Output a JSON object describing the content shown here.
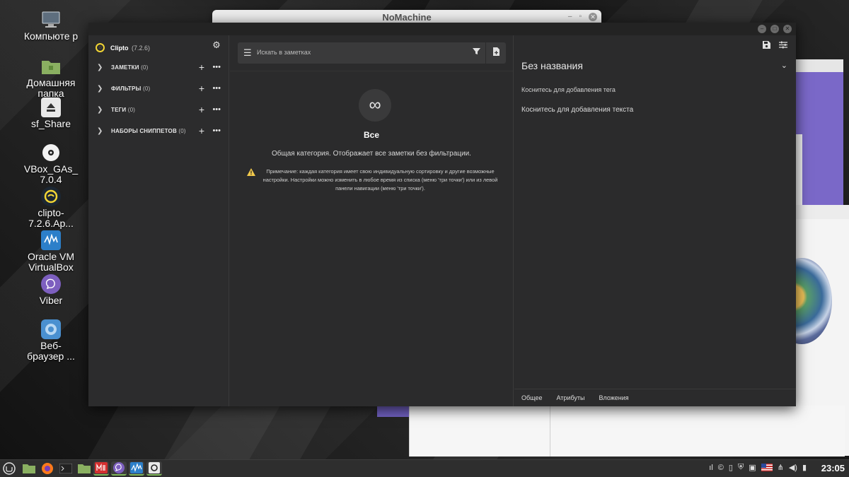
{
  "desktop": {
    "icons": [
      {
        "label": "Компьюте р",
        "icon": "computer-icon"
      },
      {
        "label": "Домашняя папка",
        "icon": "home-folder-icon"
      },
      {
        "label": "sf_Share",
        "icon": "drive-icon"
      },
      {
        "label": "VBox_GAs_ 7.0.4",
        "icon": "disc-icon"
      },
      {
        "label": "clipto- 7.2.6.Ap...",
        "icon": "clipto-icon"
      },
      {
        "label": "Oracle VM VirtualBox",
        "icon": "virtualbox-icon"
      },
      {
        "label": "Viber",
        "icon": "viber-icon"
      },
      {
        "label": "Веб- браузер ...",
        "icon": "web-browser-icon"
      }
    ]
  },
  "background_windows": {
    "nomachine_title": "NoMachine"
  },
  "clipto": {
    "brand": {
      "name": "Clipto",
      "version": "(7.2.6)"
    },
    "sidebar": {
      "items": [
        {
          "label": "ЗАМЕТКИ",
          "count": "(0)"
        },
        {
          "label": "ФИЛЬТРЫ",
          "count": "(0)"
        },
        {
          "label": "ТЕГИ",
          "count": "(0)"
        },
        {
          "label": "НАБОРЫ СНИППЕТОВ",
          "count": "(0)"
        }
      ]
    },
    "search": {
      "placeholder": "Искать в заметках"
    },
    "category": {
      "title": "Все",
      "description": "Общая категория. Отображает все заметки без фильтрации.",
      "note": "Примечание: каждая категория имеет свою индивидуальную сортировку и другие возможные настройки. Настройки можно изменить в любое время из списка (меню 'три точки') или из левой панели навигации (меню 'три точки')."
    },
    "editor": {
      "title": "Без названия",
      "tag_hint": "Коснитесь для добавления тега",
      "text_hint": "Коснитесь для добавления текста",
      "footer_tabs": [
        "Общее",
        "Атрибуты",
        "Вложения"
      ]
    }
  },
  "taskbar": {
    "apps": [
      "mint-menu-icon",
      "files-icon",
      "firefox-icon",
      "terminal-icon",
      "folder-icon",
      "nomachine-icon",
      "viber-icon",
      "virtualbox-icon",
      "clipto-icon"
    ],
    "clock": "23:05"
  },
  "colors": {
    "accent": "#f2d534",
    "taskbar_active": "#7fb75a"
  }
}
